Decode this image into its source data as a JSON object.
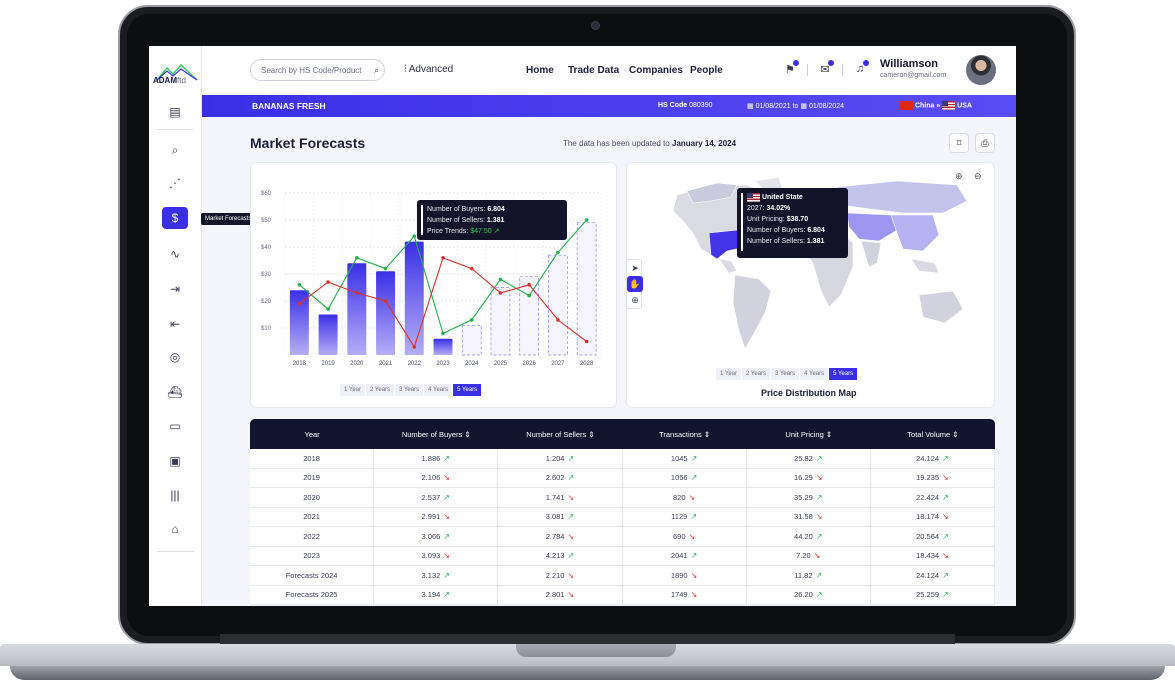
{
  "brand": {
    "name": "ADAM",
    "suffix": "ftd"
  },
  "sidebar": {
    "tooltip": "Market Forecasts"
  },
  "header": {
    "search_placeholder": "Search by HS Code/Product",
    "advanced": "Advanced",
    "nav": [
      "Home",
      "Trade Data",
      "Companies",
      "People"
    ],
    "user_name": "Williamson",
    "user_email": "cameron@gmail.com"
  },
  "bar": {
    "product": "BANANAS FRESH",
    "hs_label": "HS Code",
    "hs_value": "080390",
    "date_from": "01/08/2021",
    "date_to_word": "to",
    "date_to": "01/08/2024",
    "from_country": "China",
    "arrow": "»",
    "to_country": "USA"
  },
  "page": {
    "title": "Market Forecasts",
    "updated_prefix": "The data has been updated to",
    "updated_date": "January 14, 2024"
  },
  "chart_data": {
    "type": "bar",
    "categories": [
      "2018",
      "2019",
      "2020",
      "2021",
      "2022",
      "2023",
      "2024",
      "2025",
      "2026",
      "2027",
      "2028"
    ],
    "ylim": [
      0,
      60
    ],
    "yticks": [
      "$10",
      "$20",
      "$30",
      "$40",
      "$50",
      "$60"
    ],
    "series": [
      {
        "name": "bars",
        "values": [
          24,
          15,
          34,
          31,
          42,
          6,
          11,
          25,
          29,
          37,
          49
        ],
        "forecast_from": 6
      },
      {
        "name": "green",
        "values": [
          26,
          17,
          36,
          32,
          44,
          8,
          13,
          28,
          22,
          38,
          50
        ],
        "color": "#22b14c"
      },
      {
        "name": "red",
        "values": [
          19,
          27,
          23,
          20,
          3,
          36,
          32,
          23,
          26,
          13,
          5
        ],
        "color": "#e0302a"
      }
    ],
    "tooltip": {
      "buyers_label": "Number of Buyers:",
      "buyers": "6.804",
      "sellers_label": "Number of Sellers:",
      "sellers": "1.381",
      "price_label": "Price Trends:",
      "price": "$47.50"
    }
  },
  "year_filters": [
    "1 Year",
    "2 Years",
    "3 Years",
    "4 Years",
    "5 Years"
  ],
  "map": {
    "title": "Price Distribution Map",
    "tooltip": {
      "country": "United State",
      "year_label": "2027:",
      "year_value": "34.02%",
      "pricing_label": "Unit Pricing:",
      "pricing": "$38.70",
      "buyers_label": "Number of Buyers:",
      "buyers": "6.804",
      "sellers_label": "Number of Sellers:",
      "sellers": "1.381"
    }
  },
  "table": {
    "headers": [
      "Year",
      "Number of Buyers",
      "Number of Sellers",
      "Transactions",
      "Unit Pricing",
      "Total Volume"
    ],
    "rows": [
      [
        [
          "2018",
          ""
        ],
        [
          "1.886",
          "up"
        ],
        [
          "1.204",
          "up"
        ],
        [
          "1045",
          "up"
        ],
        [
          "25.82",
          "up"
        ],
        [
          "24.124",
          "up"
        ]
      ],
      [
        [
          "2019",
          ""
        ],
        [
          "2.106",
          "dn"
        ],
        [
          "2.602",
          "up"
        ],
        [
          "1056",
          "up"
        ],
        [
          "16.29",
          "dn"
        ],
        [
          "19.235",
          "dn"
        ]
      ],
      [
        [
          "2020",
          ""
        ],
        [
          "2.537",
          "up"
        ],
        [
          "1.741",
          "dn"
        ],
        [
          "820",
          "dn"
        ],
        [
          "35.29",
          "up"
        ],
        [
          "22.424",
          "up"
        ]
      ],
      [
        [
          "2021",
          ""
        ],
        [
          "2.991",
          "dn"
        ],
        [
          "3.081",
          "up"
        ],
        [
          "1129",
          "up"
        ],
        [
          "31.58",
          "dn"
        ],
        [
          "18.174",
          "dn"
        ]
      ],
      [
        [
          "2022",
          ""
        ],
        [
          "3.066",
          "up"
        ],
        [
          "2.784",
          "dn"
        ],
        [
          "690",
          "dn"
        ],
        [
          "44.20",
          "up"
        ],
        [
          "20.564",
          "up"
        ]
      ],
      [
        [
          "2023",
          ""
        ],
        [
          "3.093",
          "dn"
        ],
        [
          "4.213",
          "up"
        ],
        [
          "2041",
          "up"
        ],
        [
          "7.20",
          "dn"
        ],
        [
          "18.434",
          "dn"
        ]
      ],
      [
        [
          "Forecasts 2024",
          ""
        ],
        [
          "3.132",
          "up"
        ],
        [
          "2.210",
          "dn"
        ],
        [
          "1890",
          "dn"
        ],
        [
          "11.82",
          "up"
        ],
        [
          "24.124",
          "up"
        ]
      ],
      [
        [
          "Forecasts 2025",
          ""
        ],
        [
          "3.194",
          "up"
        ],
        [
          "2.801",
          "dn"
        ],
        [
          "1749",
          "dn"
        ],
        [
          "26.20",
          "up"
        ],
        [
          "25.259",
          "up"
        ]
      ]
    ]
  }
}
